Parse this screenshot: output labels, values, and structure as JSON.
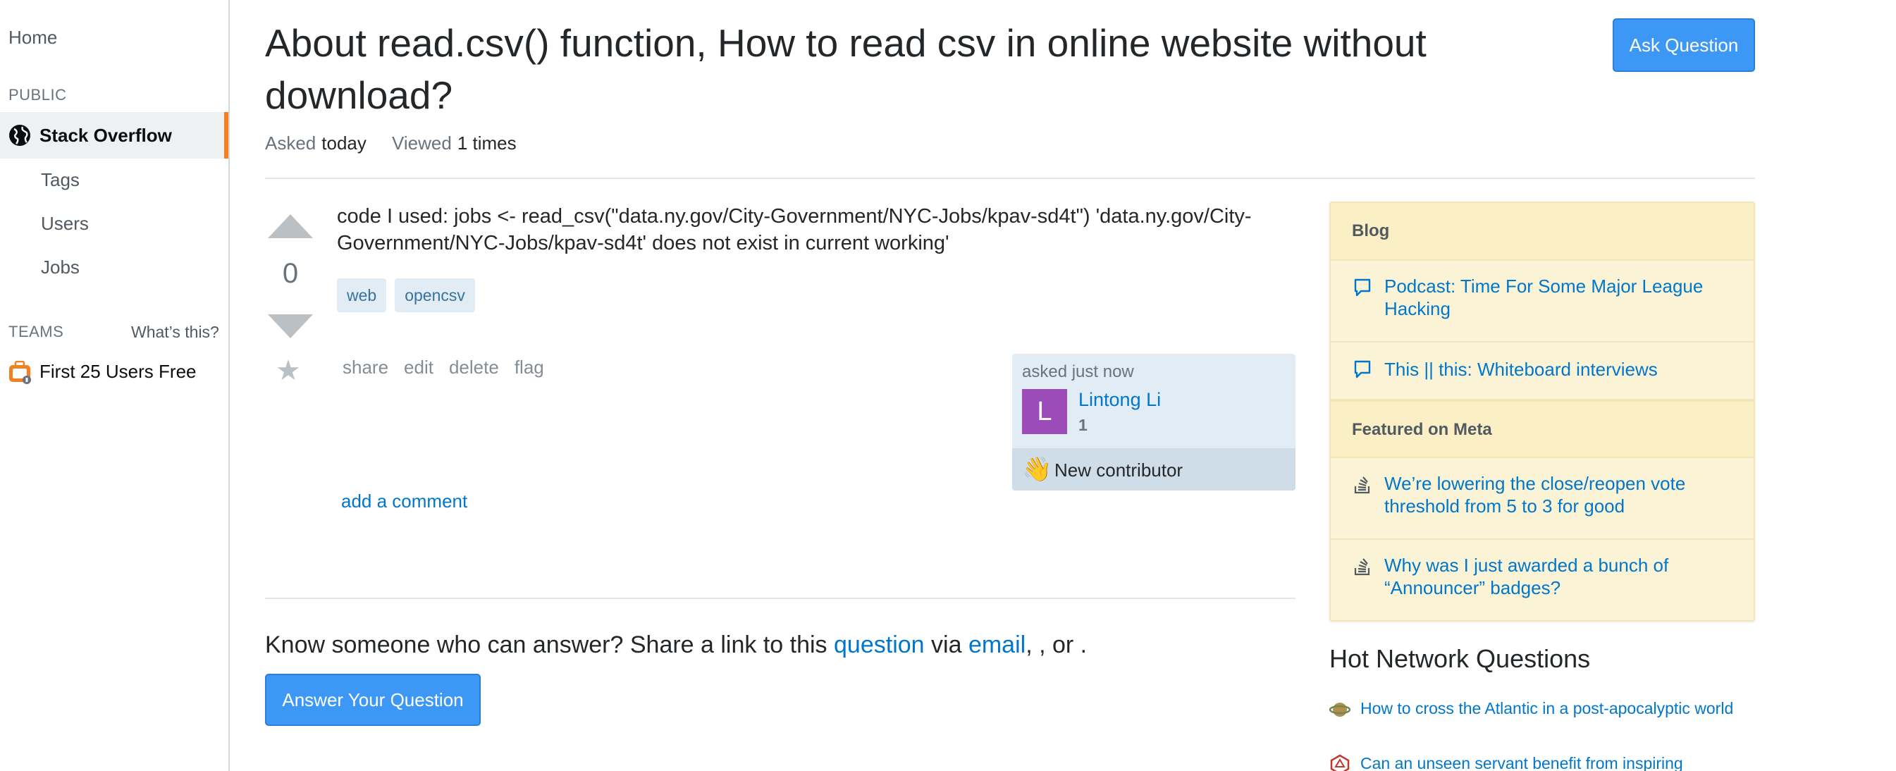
{
  "sidebar": {
    "home": "Home",
    "public_label": "PUBLIC",
    "active_item": "Stack Overflow",
    "items": [
      "Tags",
      "Users",
      "Jobs"
    ],
    "teams_label": "TEAMS",
    "whats_this": "What’s this?",
    "teams_item": "First 25 Users Free"
  },
  "header": {
    "title": "About read.csv() function, How to read csv in online website without download?",
    "ask_button": "Ask Question",
    "asked_label": "Asked",
    "asked_value": "today",
    "viewed_label": "Viewed",
    "viewed_value": "1 times"
  },
  "post": {
    "score": "0",
    "body": "code I used: jobs <- read_csv(\"data.ny.gov/City-Government/NYC-Jobs/kpav-sd4t\") 'data.ny.gov/City-Government/NYC-Jobs/kpav-sd4t' does not exist in current working'",
    "tags": [
      "web",
      "opencsv"
    ],
    "menu": [
      "share",
      "edit",
      "delete",
      "flag"
    ],
    "add_comment": "add a comment"
  },
  "user_card": {
    "asked_time": "asked just now",
    "avatar_letter": "L",
    "user_name": "Lintong Li",
    "reputation": "1",
    "new_contributor": "New contributor"
  },
  "share": {
    "prefix": "Know someone who can answer? Share a link to this",
    "question_link": "question",
    "via": "via",
    "email_link": "email",
    "suffix": ", , or ."
  },
  "answer_button": "Answer Your Question",
  "blog_widget": {
    "blog_header": "Blog",
    "blog_items": [
      "Podcast: Time For Some Major League Hacking",
      "This || this: Whiteboard interviews"
    ],
    "meta_header": "Featured on Meta",
    "meta_items": [
      "We’re lowering the close/reopen vote threshold from 5 to 3 for good",
      "Why was I just awarded a bunch of “Announcer” badges?"
    ]
  },
  "hot_network": {
    "title": "Hot Network Questions",
    "items": [
      "How to cross the Atlantic in a post-apocalyptic world",
      "Can an unseen servant benefit from inspiring"
    ]
  },
  "colors": {
    "accent_orange": "#f48024",
    "button_blue": "#3d97f5",
    "link_blue": "#0077cc",
    "widget_yellow": "#fbf3d5",
    "avatar_purple": "#9b4cb8"
  }
}
